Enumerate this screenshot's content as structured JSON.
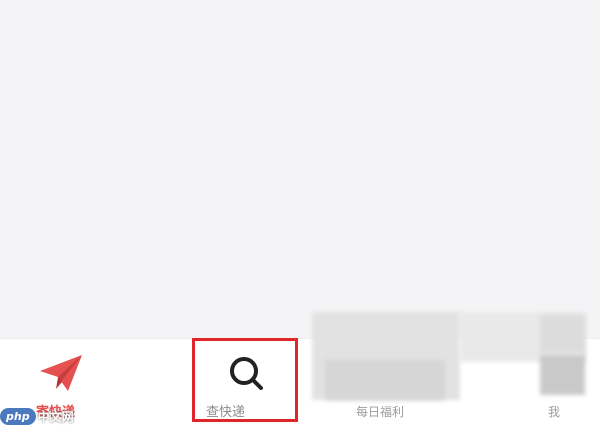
{
  "tabbar": {
    "tabs": [
      {
        "id": "send",
        "label": "寄快递",
        "icon": "paper-plane-icon",
        "active": true
      },
      {
        "id": "track",
        "label": "查快递",
        "icon": "search-icon",
        "active": false
      },
      {
        "id": "services",
        "label": "每日福利",
        "icon": "blurred-icon",
        "active": false
      },
      {
        "id": "me",
        "label": "我",
        "icon": "blurred-icon",
        "active": false
      }
    ]
  },
  "colors": {
    "accent": "#e55050",
    "highlight": "#e0262b",
    "background": "#f4f4f6"
  },
  "watermark": {
    "brand": "php",
    "site": "中文网"
  }
}
